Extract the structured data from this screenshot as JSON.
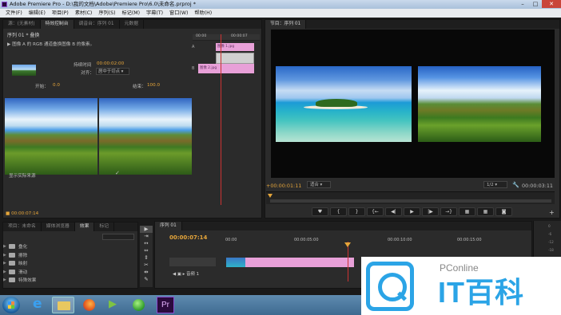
{
  "window": {
    "title": "Adobe Premiere Pro - D:\\我的文档\\Adobe\\Premiere Pro\\6.0\\未命名.prproj *"
  },
  "menu": [
    "文件(F)",
    "编辑(E)",
    "项目(P)",
    "素材(C)",
    "序列(S)",
    "标记(M)",
    "字幕(T)",
    "窗口(W)",
    "帮助(H)"
  ],
  "source_panel": {
    "tabs": [
      "源：(无素材)",
      "特效控制台",
      "调音台：序列 01",
      "元数据"
    ],
    "clip_path": "序列 01 * 叠换",
    "effect_desc": "图像 A 的 RGB 通道叠换图像 B 的像素。",
    "duration_label": "持续时间",
    "duration_value": "00:00:02:00",
    "align_label": "对齐：",
    "align_value": "居中于切点",
    "start_label": "开始：",
    "start_value": "0.0",
    "end_label": "结束：",
    "end_value": "100.0",
    "show_source_label": "显示实际来源",
    "timecode": "00:00:07:14",
    "mini_ruler": [
      "00:00",
      "00:00:07"
    ],
    "track_a_label": "图像 1.jpg",
    "track_b_label": "图像 2.jpg",
    "letters": [
      "A",
      "B"
    ]
  },
  "program_monitor": {
    "tab": "节目：序列 01",
    "timecode_left": "+00:00:01:11",
    "fit": "适合",
    "quality": "1/2",
    "timecode_right": "00:00:03:11",
    "controls": [
      "♥",
      "{",
      "}",
      "{←",
      "◀|",
      "▶",
      "|▶",
      "→}",
      "▦",
      "▦",
      "◙"
    ]
  },
  "project_panel": {
    "tabs": [
      "项目：未命名",
      "媒体浏览器",
      "效果",
      "标记"
    ],
    "items": [
      "叠化",
      "擦除",
      "映射",
      "滑动",
      "特殊效果"
    ]
  },
  "tools": [
    "▶",
    "⇥",
    "↔",
    "⇔",
    "⇕",
    "✂",
    "⇹",
    "✎",
    "✋",
    "🔍"
  ],
  "timeline": {
    "tab": "序列 01",
    "timecode": "00:00:07:14",
    "ruler": [
      "00:00",
      "00:00:05:00",
      "00:00:10:00",
      "00:00:15:00"
    ],
    "audio_track": "音频 1",
    "meter_labels": [
      "0",
      "-6",
      "-12",
      "-18",
      "-24",
      "-30",
      "-36",
      "-42",
      "-48"
    ]
  },
  "watermark": {
    "sub": "PConline",
    "main": "IT百科"
  }
}
